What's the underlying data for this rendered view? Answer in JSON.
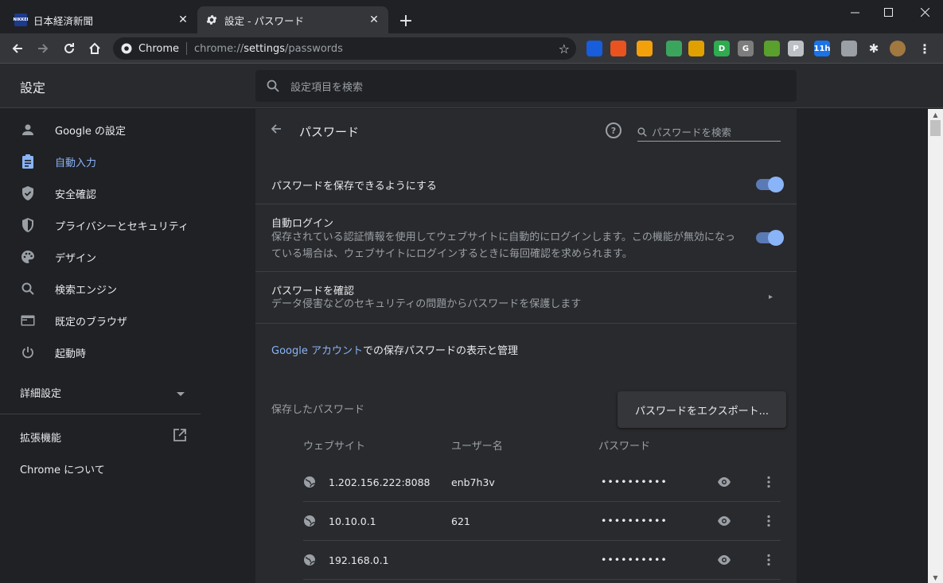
{
  "tabs": [
    {
      "title": "日本経済新聞",
      "favicon": "nikkei-icon",
      "favicon_text": "NIKKEI",
      "active": false
    },
    {
      "title": "設定 - パスワード",
      "favicon": "gear-icon",
      "active": true
    }
  ],
  "omnibox": {
    "site_label": "Chrome",
    "url_prefix": "chrome://",
    "url_host": "settings",
    "url_path": "/passwords"
  },
  "extensions": [
    {
      "icon": "bitwarden-icon",
      "color": "#175ddc",
      "text": ""
    },
    {
      "icon": "honey-icon",
      "color": "#e8531f",
      "text": ""
    },
    {
      "icon": "fork-icon",
      "color": "#f3a10b",
      "text": ""
    },
    {
      "icon": "phone-icon",
      "color": "#3ba55d",
      "text": ""
    },
    {
      "icon": "badge-extension-icon",
      "color": "#e0a000",
      "text": ""
    },
    {
      "icon": "d-icon",
      "color": "#2eac4f",
      "text": "D"
    },
    {
      "icon": "g-icon",
      "color": "#7d7d7d",
      "text": "G"
    },
    {
      "icon": "puzzle-green-icon",
      "color": "#5aa02c",
      "text": ""
    },
    {
      "icon": "pinterest-icon",
      "color": "#bdc1c6",
      "text": "P"
    },
    {
      "icon": "calendar-icon",
      "color": "#1a73e8",
      "text": "11h"
    },
    {
      "icon": "ink-icon",
      "color": "#9aa0a6",
      "text": ""
    }
  ],
  "header": {
    "title": "設定",
    "search_placeholder": "設定項目を検索"
  },
  "sidebar": {
    "items": [
      {
        "label": "Google の設定",
        "icon": "person-icon"
      },
      {
        "label": "自動入力",
        "icon": "clipboard-icon",
        "selected": true
      },
      {
        "label": "安全確認",
        "icon": "shield-check-icon"
      },
      {
        "label": "プライバシーとセキュリティ",
        "icon": "shield-icon"
      },
      {
        "label": "デザイン",
        "icon": "palette-icon"
      },
      {
        "label": "検索エンジン",
        "icon": "search-icon"
      },
      {
        "label": "既定のブラウザ",
        "icon": "browser-icon"
      },
      {
        "label": "起動時",
        "icon": "power-icon"
      }
    ],
    "advanced": "詳細設定",
    "extensions": "拡張機能",
    "about": "Chrome について"
  },
  "passwords": {
    "title": "パスワード",
    "search_placeholder": "パスワードを検索",
    "offer_to_save": "パスワードを保存できるようにする",
    "offer_to_save_on": true,
    "auto_signin_title": "自動ログイン",
    "auto_signin_desc_1": "保存されている認証情報を使用してウェブサイトに自動的にログインします。この機能が無効になっ",
    "auto_signin_desc_2": "ている場合は、ウェブサイトにログインするときに毎回確認を求められます。",
    "auto_signin_on": true,
    "check_title": "パスワードを確認",
    "check_desc": "データ侵害などのセキュリティの問題からパスワードを保護します",
    "google_account_link": "Google アカウント",
    "google_account_suffix": "での保存パスワードの表示と管理",
    "saved_label": "保存したパスワード",
    "export_label": "パスワードをエクスポート...",
    "columns": {
      "site": "ウェブサイト",
      "user": "ユーザー名",
      "password": "パスワード"
    },
    "entries": [
      {
        "site": "1.202.156.222:8088",
        "user": "enb7h3v",
        "password": "••••••••••"
      },
      {
        "site": "10.10.0.1",
        "user": "621",
        "password": "••••••••••"
      },
      {
        "site": "192.168.0.1",
        "user": "",
        "password": "••••••••••"
      }
    ]
  }
}
